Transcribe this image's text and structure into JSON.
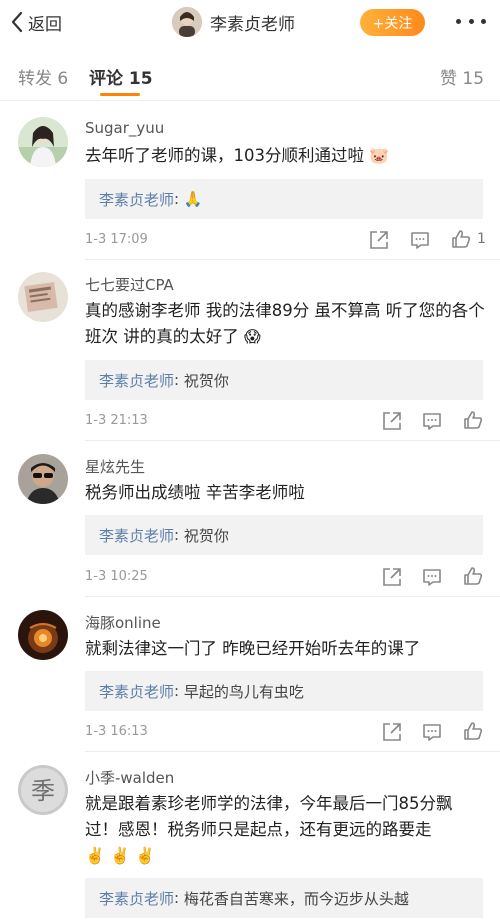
{
  "nav": {
    "back_label": "返回",
    "title": "李素贞老师",
    "follow_label": "+关注"
  },
  "tabs": {
    "repost": "转发 6",
    "comment": "评论 15",
    "like": "赞 15"
  },
  "comments": [
    {
      "name": "Sugar_yuu",
      "text": "去年听了老师的课，103分顺利通过啦",
      "emoji": "🐷",
      "reply_name": "李素贞老师",
      "reply_text": "🙏",
      "time": "1-3 17:09",
      "like_count": "1"
    },
    {
      "name": "七七要过CPA",
      "text": "真的感谢李老师  我的法律89分  虽不算高  听了您的各个班次  讲的真的太好了",
      "emoji": "😱",
      "reply_name": "李素贞老师",
      "reply_text": "祝贺你",
      "time": "1-3 21:13"
    },
    {
      "name": "星炫先生",
      "text": "税务师出成绩啦  辛苦李老师啦",
      "reply_name": "李素贞老师",
      "reply_text": "祝贺你",
      "time": "1-3 10:25"
    },
    {
      "name": "海豚online",
      "text": "就剩法律这一门了  昨晚已经开始听去年的课了",
      "reply_name": "李素贞老师",
      "reply_text": "早起的鸟儿有虫吃",
      "time": "1-3 16:13"
    },
    {
      "name": "小季-walden",
      "text": "就是跟着素珍老师学的法律，今年最后一门85分飘过！感恩！税务师只是起点，还有更远的路要走",
      "emoji": "✌️ ✌️ ✌️",
      "reply_name": "李素贞老师",
      "reply_text": "梅花香自苦寒来，而今迈步从头越",
      "avatar_text": "季"
    }
  ],
  "colors": {
    "accent": "#ff8200",
    "link": "#5d7ea8",
    "reply_bg": "#f2f2f2"
  },
  "icons": {
    "back": "chevron-left-icon",
    "more": "more-dots-icon",
    "repost": "repost-icon",
    "comment": "comment-icon",
    "like": "thumbs-up-icon"
  }
}
